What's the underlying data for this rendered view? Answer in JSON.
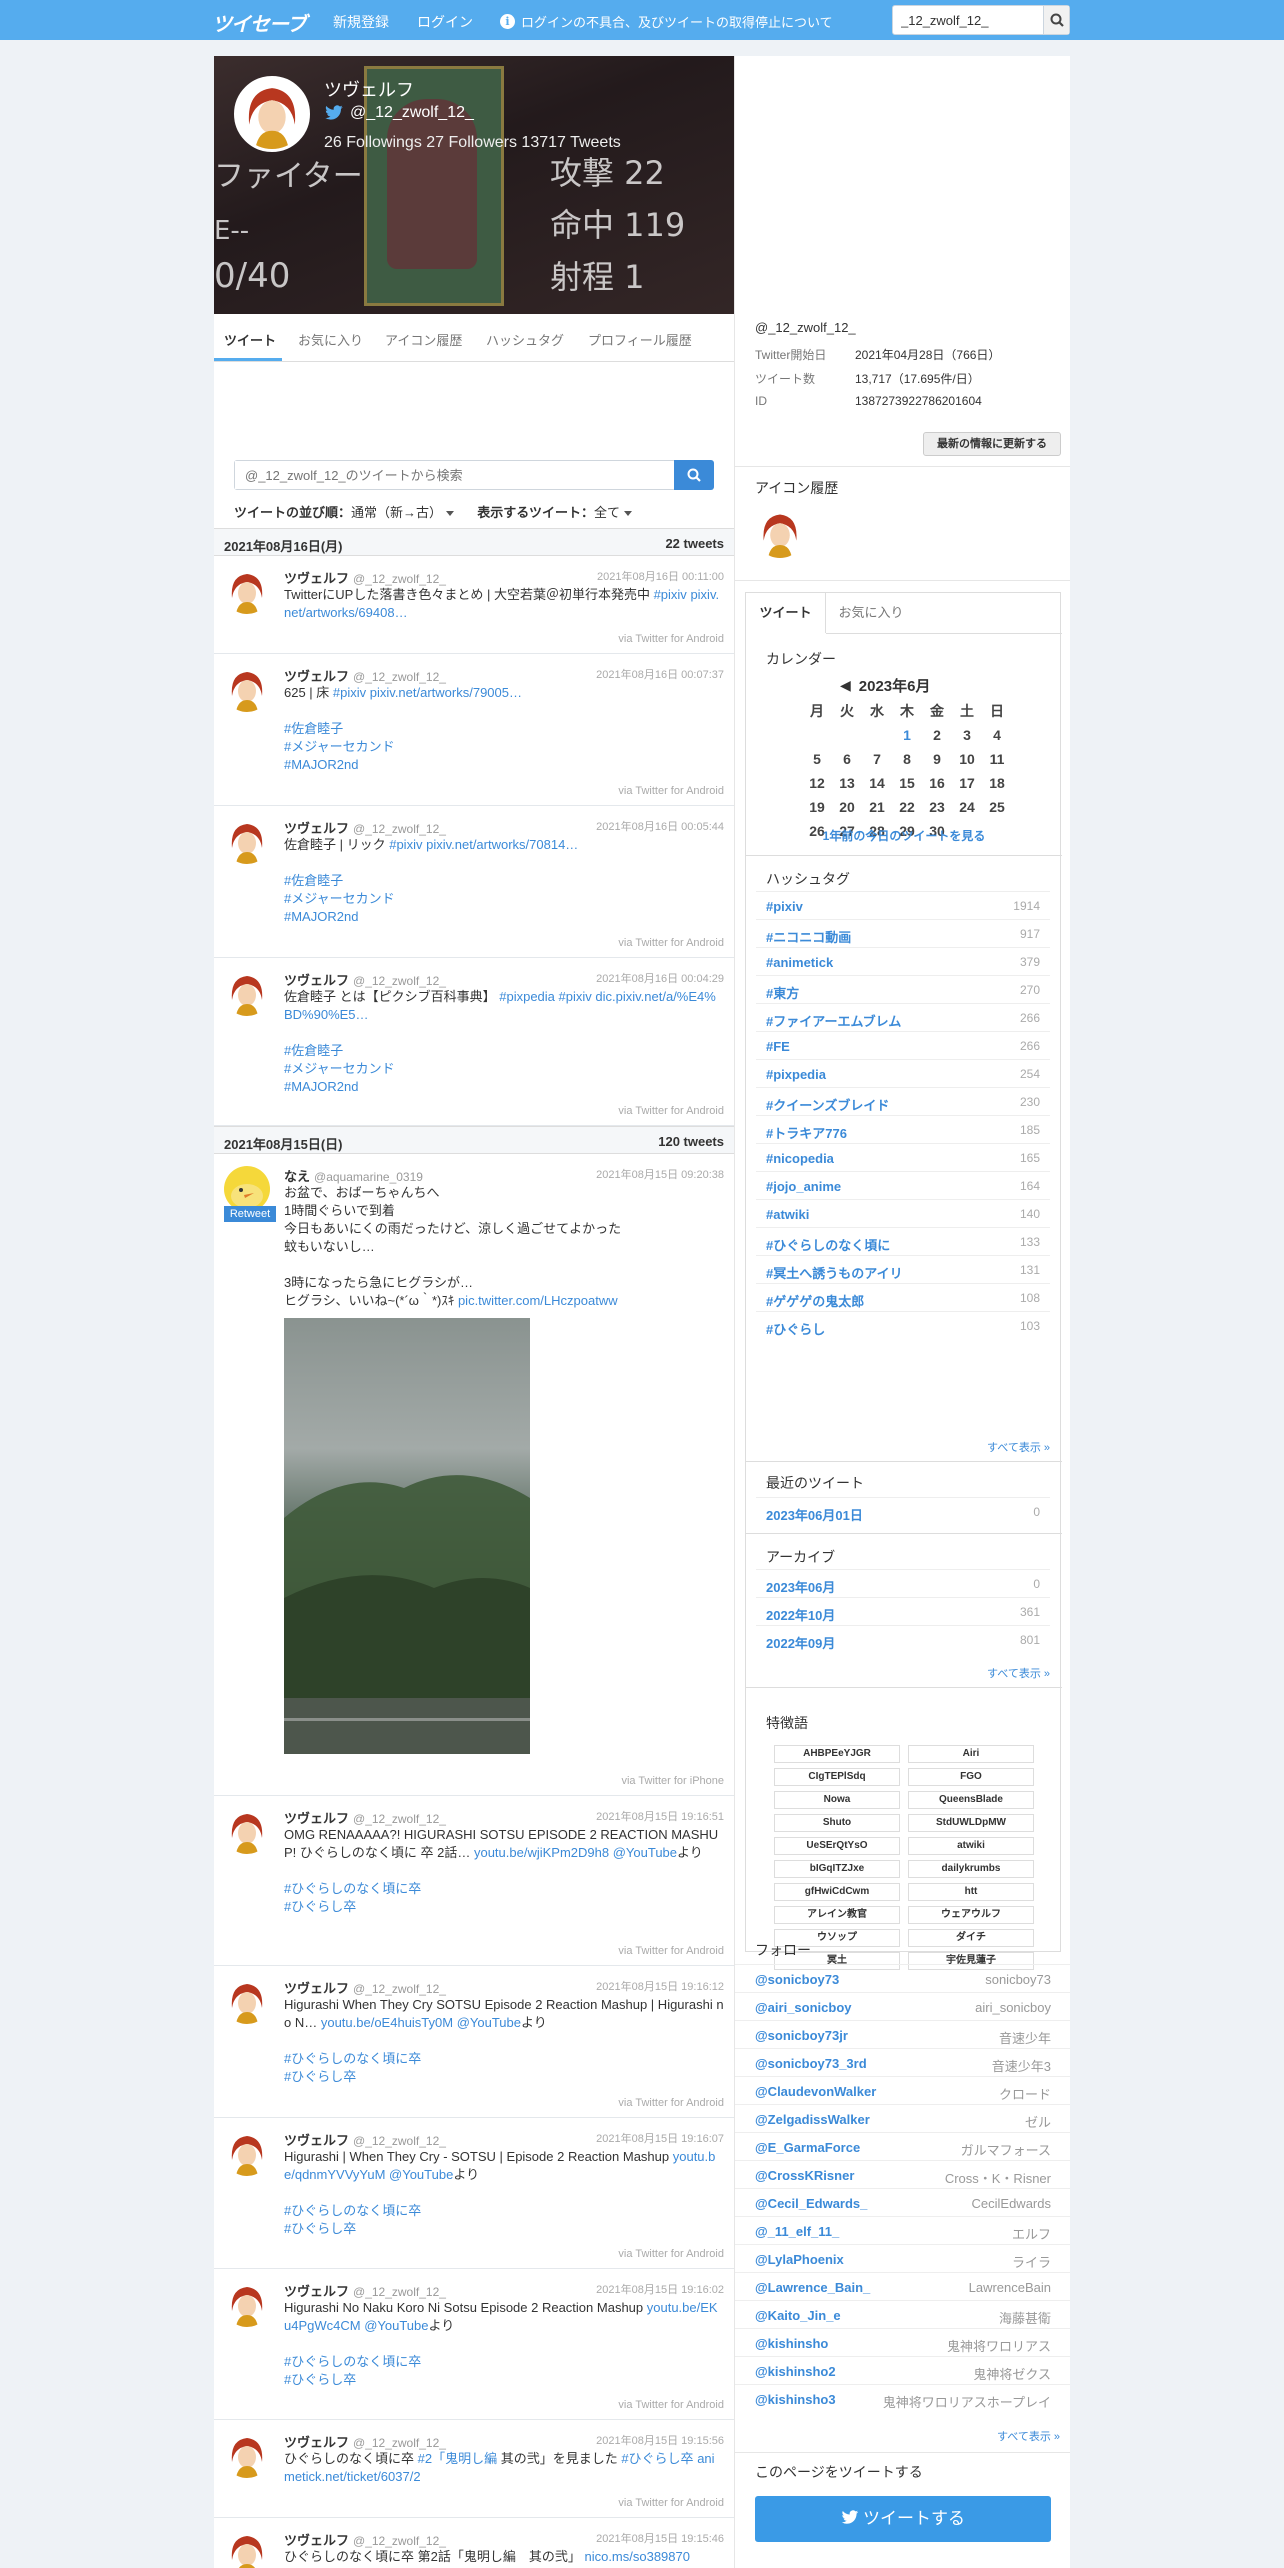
{
  "header": {
    "logo": "ツイセーブ",
    "nav": [
      "新規登録",
      "ログイン"
    ],
    "notice": "ログインの不具合、及びツイートの取得停止について",
    "search_value": "_12_zwolf_12_",
    "accent": "#55acee"
  },
  "profile": {
    "name": "ツヴェルフ",
    "handle": "@_12_zwolf_12_",
    "stats": "26 Followings  27 Followers   13717 Tweets",
    "banner_text": [
      "ファイター",
      "E--",
      "0/40",
      "攻撃 22",
      "命中 119",
      "射程 1"
    ]
  },
  "tabs": [
    "ツイート",
    "お気に入り",
    "アイコン履歴",
    "ハッシュタグ",
    "プロフィール履歴"
  ],
  "tweet_search": {
    "placeholder": "@_12_zwolf_12_のツイートから検索"
  },
  "sort": {
    "order_label": "ツイートの並び順：",
    "order_value": "通常（新→古）",
    "filter_label": "表示するツイート：",
    "filter_value": "全て"
  },
  "days": [
    {
      "date": "2021年08月16日(月)",
      "count": "22 tweets"
    },
    {
      "date": "2021年08月15日(日)",
      "count": "120 tweets"
    }
  ],
  "tweets": [
    {
      "name": "ツヴェルフ",
      "handle": "@_12_zwolf_12_",
      "time": "2021年08月16日 00:11:00",
      "text": "TwitterにUPした落書き色々まとめ | 大空若葉＠初単行本発売中 #pixiv pixiv.net/artworks/69408…",
      "via": "via Twitter for Android"
    },
    {
      "name": "ツヴェルフ",
      "handle": "@_12_zwolf_12_",
      "time": "2021年08月16日 00:07:37",
      "text": "625 | 床 #pixiv pixiv.net/artworks/79005…\n\n#佐倉睦子\n#メジャーセカンド\n#MAJOR2nd",
      "via": "via Twitter for Android"
    },
    {
      "name": "ツヴェルフ",
      "handle": "@_12_zwolf_12_",
      "time": "2021年08月16日 00:05:44",
      "text": "佐倉睦子 | リック #pixiv pixiv.net/artworks/70814…\n\n#佐倉睦子\n#メジャーセカンド\n#MAJOR2nd",
      "via": "via Twitter for Android"
    },
    {
      "name": "ツヴェルフ",
      "handle": "@_12_zwolf_12_",
      "time": "2021年08月16日 00:04:29",
      "text": "佐倉睦子 とは【ピクシブ百科事典】 #pixpedia #pixiv dic.pixiv.net/a/%E4%BD%90%E5…\n\n#佐倉睦子\n#メジャーセカンド\n#MAJOR2nd",
      "via": "via Twitter for Android"
    },
    {
      "name": "なえ",
      "handle": "@aquamarine_0319",
      "time": "2021年08月15日 09:20:38",
      "text": "お盆で、おばーちゃんちへ\n1時間ぐらいで到着\n今日もあいにくの雨だったけど、涼しく過ごせてよかった\n蚊もいないし…\n\n3時になったら急にヒグラシが…\nヒグラシ、いいね~(*´ω｀*)ｽｷ pic.twitter.com/LHczpoatww",
      "via": "via Twitter for iPhone",
      "retweet": "Retweet"
    },
    {
      "name": "ツヴェルフ",
      "handle": "@_12_zwolf_12_",
      "time": "2021年08月15日 19:16:51",
      "text": "OMG RENAAAAA?! HIGURASHI SOTSU EPISODE 2 REACTION MASHUP! ひぐらしのなく頃に 卒 2話… youtu.be/wjiKPm2D9h8 @YouTubeより\n\n#ひぐらしのなく頃に卒\n#ひぐらし卒",
      "via": "via Twitter for Android"
    },
    {
      "name": "ツヴェルフ",
      "handle": "@_12_zwolf_12_",
      "time": "2021年08月15日 19:16:12",
      "text": "Higurashi When They Cry SOTSU Episode 2 Reaction Mashup | Higurashi no N… youtu.be/oE4huisTy0M @YouTubeより\n\n#ひぐらしのなく頃に卒\n#ひぐらし卒",
      "via": "via Twitter for Android"
    },
    {
      "name": "ツヴェルフ",
      "handle": "@_12_zwolf_12_",
      "time": "2021年08月15日 19:16:07",
      "text": "Higurashi | When They Cry - SOTSU | Episode 2 Reaction Mashup youtu.be/qdnmYVVyYuM @YouTubeより\n\n#ひぐらしのなく頃に卒\n#ひぐらし卒",
      "via": "via Twitter for Android"
    },
    {
      "name": "ツヴェルフ",
      "handle": "@_12_zwolf_12_",
      "time": "2021年08月15日 19:16:02",
      "text": "Higurashi No Naku Koro Ni Sotsu Episode 2 Reaction Mashup youtu.be/EKu4PgWc4CM @YouTubeより\n\n#ひぐらしのなく頃に卒\n#ひぐらし卒",
      "via": "via Twitter for Android"
    },
    {
      "name": "ツヴェルフ",
      "handle": "@_12_zwolf_12_",
      "time": "2021年08月15日 19:15:56",
      "text": "ひぐらしのなく頃に卒 #2「鬼明し編 其の弐」を見ました #ひぐらし卒 animetick.net/ticket/6037/2",
      "via": "via Twitter for Android"
    },
    {
      "name": "ツヴェルフ",
      "handle": "@_12_zwolf_12_",
      "time": "2021年08月15日 19:15:46",
      "text": "ひぐらしのなく頃に卒 第2話「鬼明し編　其の弐」 nico.ms/so389870",
      "via": ""
    }
  ],
  "side": {
    "handle": "@_12_zwolf_12_",
    "info": [
      {
        "k": "Twitter開始日",
        "v": "2021年04月28日（766日）"
      },
      {
        "k": "ツイート数",
        "v": "13,717（17.695件/日）"
      },
      {
        "k": "ID",
        "v": "1387273922786201604"
      }
    ],
    "refresh_button": "最新の情報に更新する",
    "icon_history_title": "アイコン履歴",
    "box_tabs": [
      "ツイート",
      "お気に入り"
    ],
    "calendar_title": "カレンダー",
    "calendar_month": "2023年6月",
    "weekdays": [
      "月",
      "火",
      "水",
      "木",
      "金",
      "土",
      "日"
    ],
    "weeks": [
      [
        "",
        "",
        "",
        "1",
        "2",
        "3",
        "4"
      ],
      [
        "5",
        "6",
        "7",
        "8",
        "9",
        "10",
        "11"
      ],
      [
        "12",
        "13",
        "14",
        "15",
        "16",
        "17",
        "18"
      ],
      [
        "19",
        "20",
        "21",
        "22",
        "23",
        "24",
        "25"
      ],
      [
        "26",
        "27",
        "28",
        "29",
        "30",
        "",
        ""
      ]
    ],
    "calendar_link": "1年前の今日のツイートを見る",
    "hashtag_title": "ハッシュタグ",
    "hashtags": [
      {
        "tag": "#pixiv",
        "count": "1914"
      },
      {
        "tag": "#ニコニコ動画",
        "count": "917"
      },
      {
        "tag": "#animetick",
        "count": "379"
      },
      {
        "tag": "#東方",
        "count": "270"
      },
      {
        "tag": "#ファイアーエムブレム",
        "count": "266"
      },
      {
        "tag": "#FE",
        "count": "266"
      },
      {
        "tag": "#pixpedia",
        "count": "254"
      },
      {
        "tag": "#クイーンズブレイド",
        "count": "230"
      },
      {
        "tag": "#トラキア776",
        "count": "185"
      },
      {
        "tag": "#nicopedia",
        "count": "165"
      },
      {
        "tag": "#jojo_anime",
        "count": "164"
      },
      {
        "tag": "#atwiki",
        "count": "140"
      },
      {
        "tag": "#ひぐらしのなく頃に",
        "count": "133"
      },
      {
        "tag": "#冥土へ誘うものアイリ",
        "count": "131"
      },
      {
        "tag": "#ゲゲゲの鬼太郎",
        "count": "108"
      },
      {
        "tag": "#ひぐらし",
        "count": "103"
      }
    ],
    "show_all": "すべて表示 »",
    "recent_title": "最近のツイート",
    "recent": [
      {
        "m": "2023年06月01日",
        "c": "0"
      }
    ],
    "archive_title": "アーカイブ",
    "archive": [
      {
        "m": "2023年06月",
        "c": "0"
      },
      {
        "m": "2022年10月",
        "c": "361"
      },
      {
        "m": "2022年09月",
        "c": "801"
      }
    ],
    "feature_title": "特徴語",
    "features": [
      "AHBPEeYJGR",
      "Airi",
      "CIgTEPlSdq",
      "FGO",
      "Nowa",
      "QueensBlade",
      "Shuto",
      "StdUWLDpMW",
      "UeSErQtYsO",
      "atwiki",
      "bIGqITZJxe",
      "dailykrumbs",
      "gfHwiCdCwm",
      "htt",
      "アレイン教官",
      "ウェアウルフ",
      "ウソップ",
      "ダイチ",
      "冥土",
      "宇佐見蓮子"
    ],
    "follow_title": "フォロー",
    "follows": [
      {
        "h": "@sonicboy73",
        "n": "sonicboy73"
      },
      {
        "h": "@airi_sonicboy",
        "n": "airi_sonicboy"
      },
      {
        "h": "@sonicboy73jr",
        "n": "音速少年"
      },
      {
        "h": "@sonicboy73_3rd",
        "n": "音速少年3"
      },
      {
        "h": "@ClaudevonWalker",
        "n": "クロード"
      },
      {
        "h": "@ZelgadissWalker",
        "n": "ゼル"
      },
      {
        "h": "@E_GarmaForce",
        "n": "ガルマフォース"
      },
      {
        "h": "@CrossKRisner",
        "n": "Cross・K・Risner"
      },
      {
        "h": "@Cecil_Edwards_",
        "n": "CecilEdwards"
      },
      {
        "h": "@_11_elf_11_",
        "n": "エルフ"
      },
      {
        "h": "@LylaPhoenix",
        "n": "ライラ"
      },
      {
        "h": "@Lawrence_Bain_",
        "n": "LawrenceBain"
      },
      {
        "h": "@Kaito_Jin_e",
        "n": "海藤甚衛"
      },
      {
        "h": "@kishinsho",
        "n": "鬼神将ワロリアス"
      },
      {
        "h": "@kishinsho2",
        "n": "鬼神将ゼクス"
      },
      {
        "h": "@kishinsho3",
        "n": "鬼神将ワロリアスホープレイ"
      }
    ],
    "share_title": "このページをツイートする",
    "share_button": "ツイートする"
  }
}
